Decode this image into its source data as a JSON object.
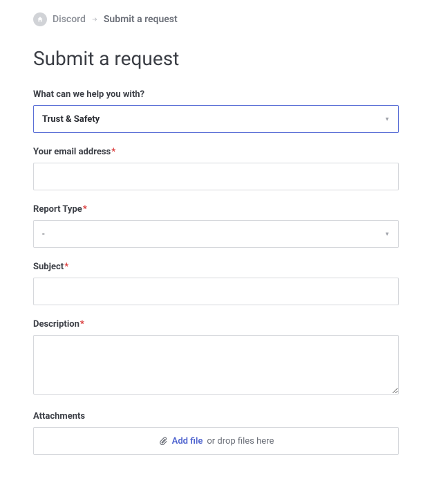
{
  "breadcrumb": {
    "home_link": "Discord",
    "current": "Submit a request"
  },
  "page": {
    "title": "Submit a request"
  },
  "fields": {
    "help_with": {
      "label": "What can we help you with?",
      "selected": "Trust & Safety",
      "required": false
    },
    "email": {
      "label": "Your email address",
      "value": "",
      "required": true
    },
    "report_type": {
      "label": "Report Type",
      "selected": "-",
      "required": true
    },
    "subject": {
      "label": "Subject",
      "value": "",
      "required": true
    },
    "description": {
      "label": "Description",
      "value": "",
      "required": true
    },
    "attachments": {
      "label": "Attachments",
      "add_file": "Add file",
      "drop_hint": " or drop files here"
    }
  },
  "required_marker": "*"
}
